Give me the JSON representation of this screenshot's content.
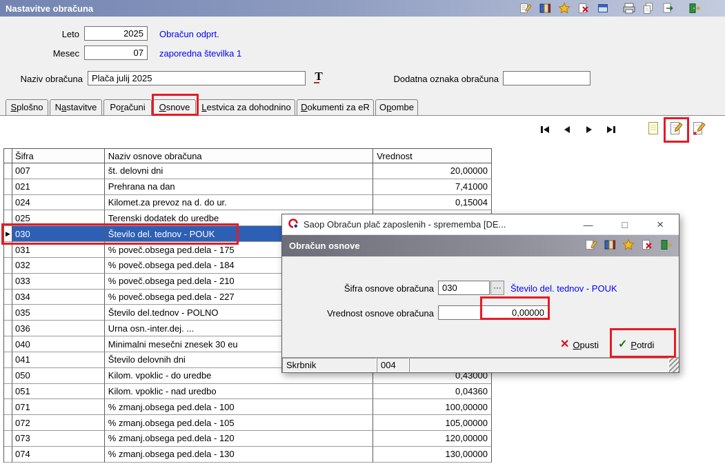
{
  "window": {
    "title": "Nastavitve obračuna",
    "toolbar_icons": [
      "edit",
      "lookup",
      "favorites",
      "delete",
      "window",
      "print",
      "copy",
      "export",
      "exit"
    ]
  },
  "form": {
    "leto_label": "Leto",
    "leto_value": "2025",
    "leto_status": "Obračun odprt.",
    "mesec_label": "Mesec",
    "mesec_value": "07",
    "mesec_status": "zaporedna številka 1",
    "naziv_label": "Naziv obračuna",
    "naziv_value": "Plača julij 2025",
    "font_button": "T",
    "dodatna_label": "Dodatna oznaka obračuna",
    "dodatna_value": ""
  },
  "tabs": [
    {
      "label": "Splošno"
    },
    {
      "label": "Nastavitve"
    },
    {
      "label": "Poračuni"
    },
    {
      "label": "Osnove"
    },
    {
      "label": "Lestvica za dohodnino"
    },
    {
      "label": "Dokumenti za eR"
    },
    {
      "label": "Opombe"
    }
  ],
  "nav_icons": [
    "first-record",
    "previous-record",
    "next-record",
    "last-record"
  ],
  "record_action_icons": [
    "insert-record",
    "edit-record",
    "edit-advanced"
  ],
  "table": {
    "columns": [
      "Šifra",
      "Naziv osnove obračuna",
      "Vrednost"
    ],
    "rows": [
      {
        "code": "007",
        "name": "št. delovni dni",
        "value": "20,00000"
      },
      {
        "code": "021",
        "name": "Prehrana na dan",
        "value": "7,41000"
      },
      {
        "code": "024",
        "name": "Kilomet.za prevoz na d. do ur.",
        "value": "0,15004"
      },
      {
        "code": "025",
        "name": "Terenski dodatek do uredbe",
        "value": ""
      },
      {
        "code": "030",
        "name": "Število del. tednov - POUK",
        "value": "",
        "selected": true
      },
      {
        "code": "031",
        "name": "% poveč.obsega ped.dela - 175",
        "value": ""
      },
      {
        "code": "032",
        "name": "% poveč.obsega ped.dela - 184",
        "value": ""
      },
      {
        "code": "033",
        "name": "% poveč.obsega ped.dela - 210",
        "value": ""
      },
      {
        "code": "034",
        "name": "% poveč.obsega ped.dela - 227",
        "value": ""
      },
      {
        "code": "035",
        "name": "Število del.tednov - POLNO",
        "value": ""
      },
      {
        "code": "036",
        "name": "Urna osn.-inter.dej. ...",
        "value": ""
      },
      {
        "code": "040",
        "name": "Minimalni mesečni znesek 30 eu",
        "value": ""
      },
      {
        "code": "041",
        "name": "Število delovnih dni",
        "value": ""
      },
      {
        "code": "050",
        "name": "Kilom. vpoklic - do uredbe",
        "value": "0,43000"
      },
      {
        "code": "051",
        "name": "Kilom. vpoklic - nad uredbo",
        "value": "0,04360"
      },
      {
        "code": "071",
        "name": "% zmanj.obsega ped.dela - 100",
        "value": "100,00000"
      },
      {
        "code": "072",
        "name": "% zmanj.obsega ped.dela - 105",
        "value": "105,00000"
      },
      {
        "code": "073",
        "name": "% zmanj.obsega ped.dela - 120",
        "value": "120,00000"
      },
      {
        "code": "074",
        "name": "% zmanj.obsega ped.dela - 130",
        "value": "130,00000"
      }
    ]
  },
  "dialog": {
    "title": "Saop Obračun plač zaposlenih - sprememba [DE...",
    "controls": {
      "minimize": "—",
      "maximize": "□",
      "close": "×"
    },
    "panel_title": "Obračun osnove",
    "header_icons": [
      "edit",
      "lookup",
      "favorites",
      "delete",
      "exit"
    ],
    "sifra_label": "Šifra osnove obračuna",
    "sifra_value": "030",
    "lookup_button": "···",
    "sifra_name": "Število del. tednov - POUK",
    "vrednost_label": "Vrednost osnove obračuna",
    "vrednost_value": "0,00000",
    "opusti_icon": "✕",
    "opusti_label": "Opusti",
    "potrdi_icon": "✓",
    "potrdi_label": "Potrdi",
    "status_left": "Skrbnik",
    "status_right": "004"
  },
  "annotation_color": "#e51b24"
}
